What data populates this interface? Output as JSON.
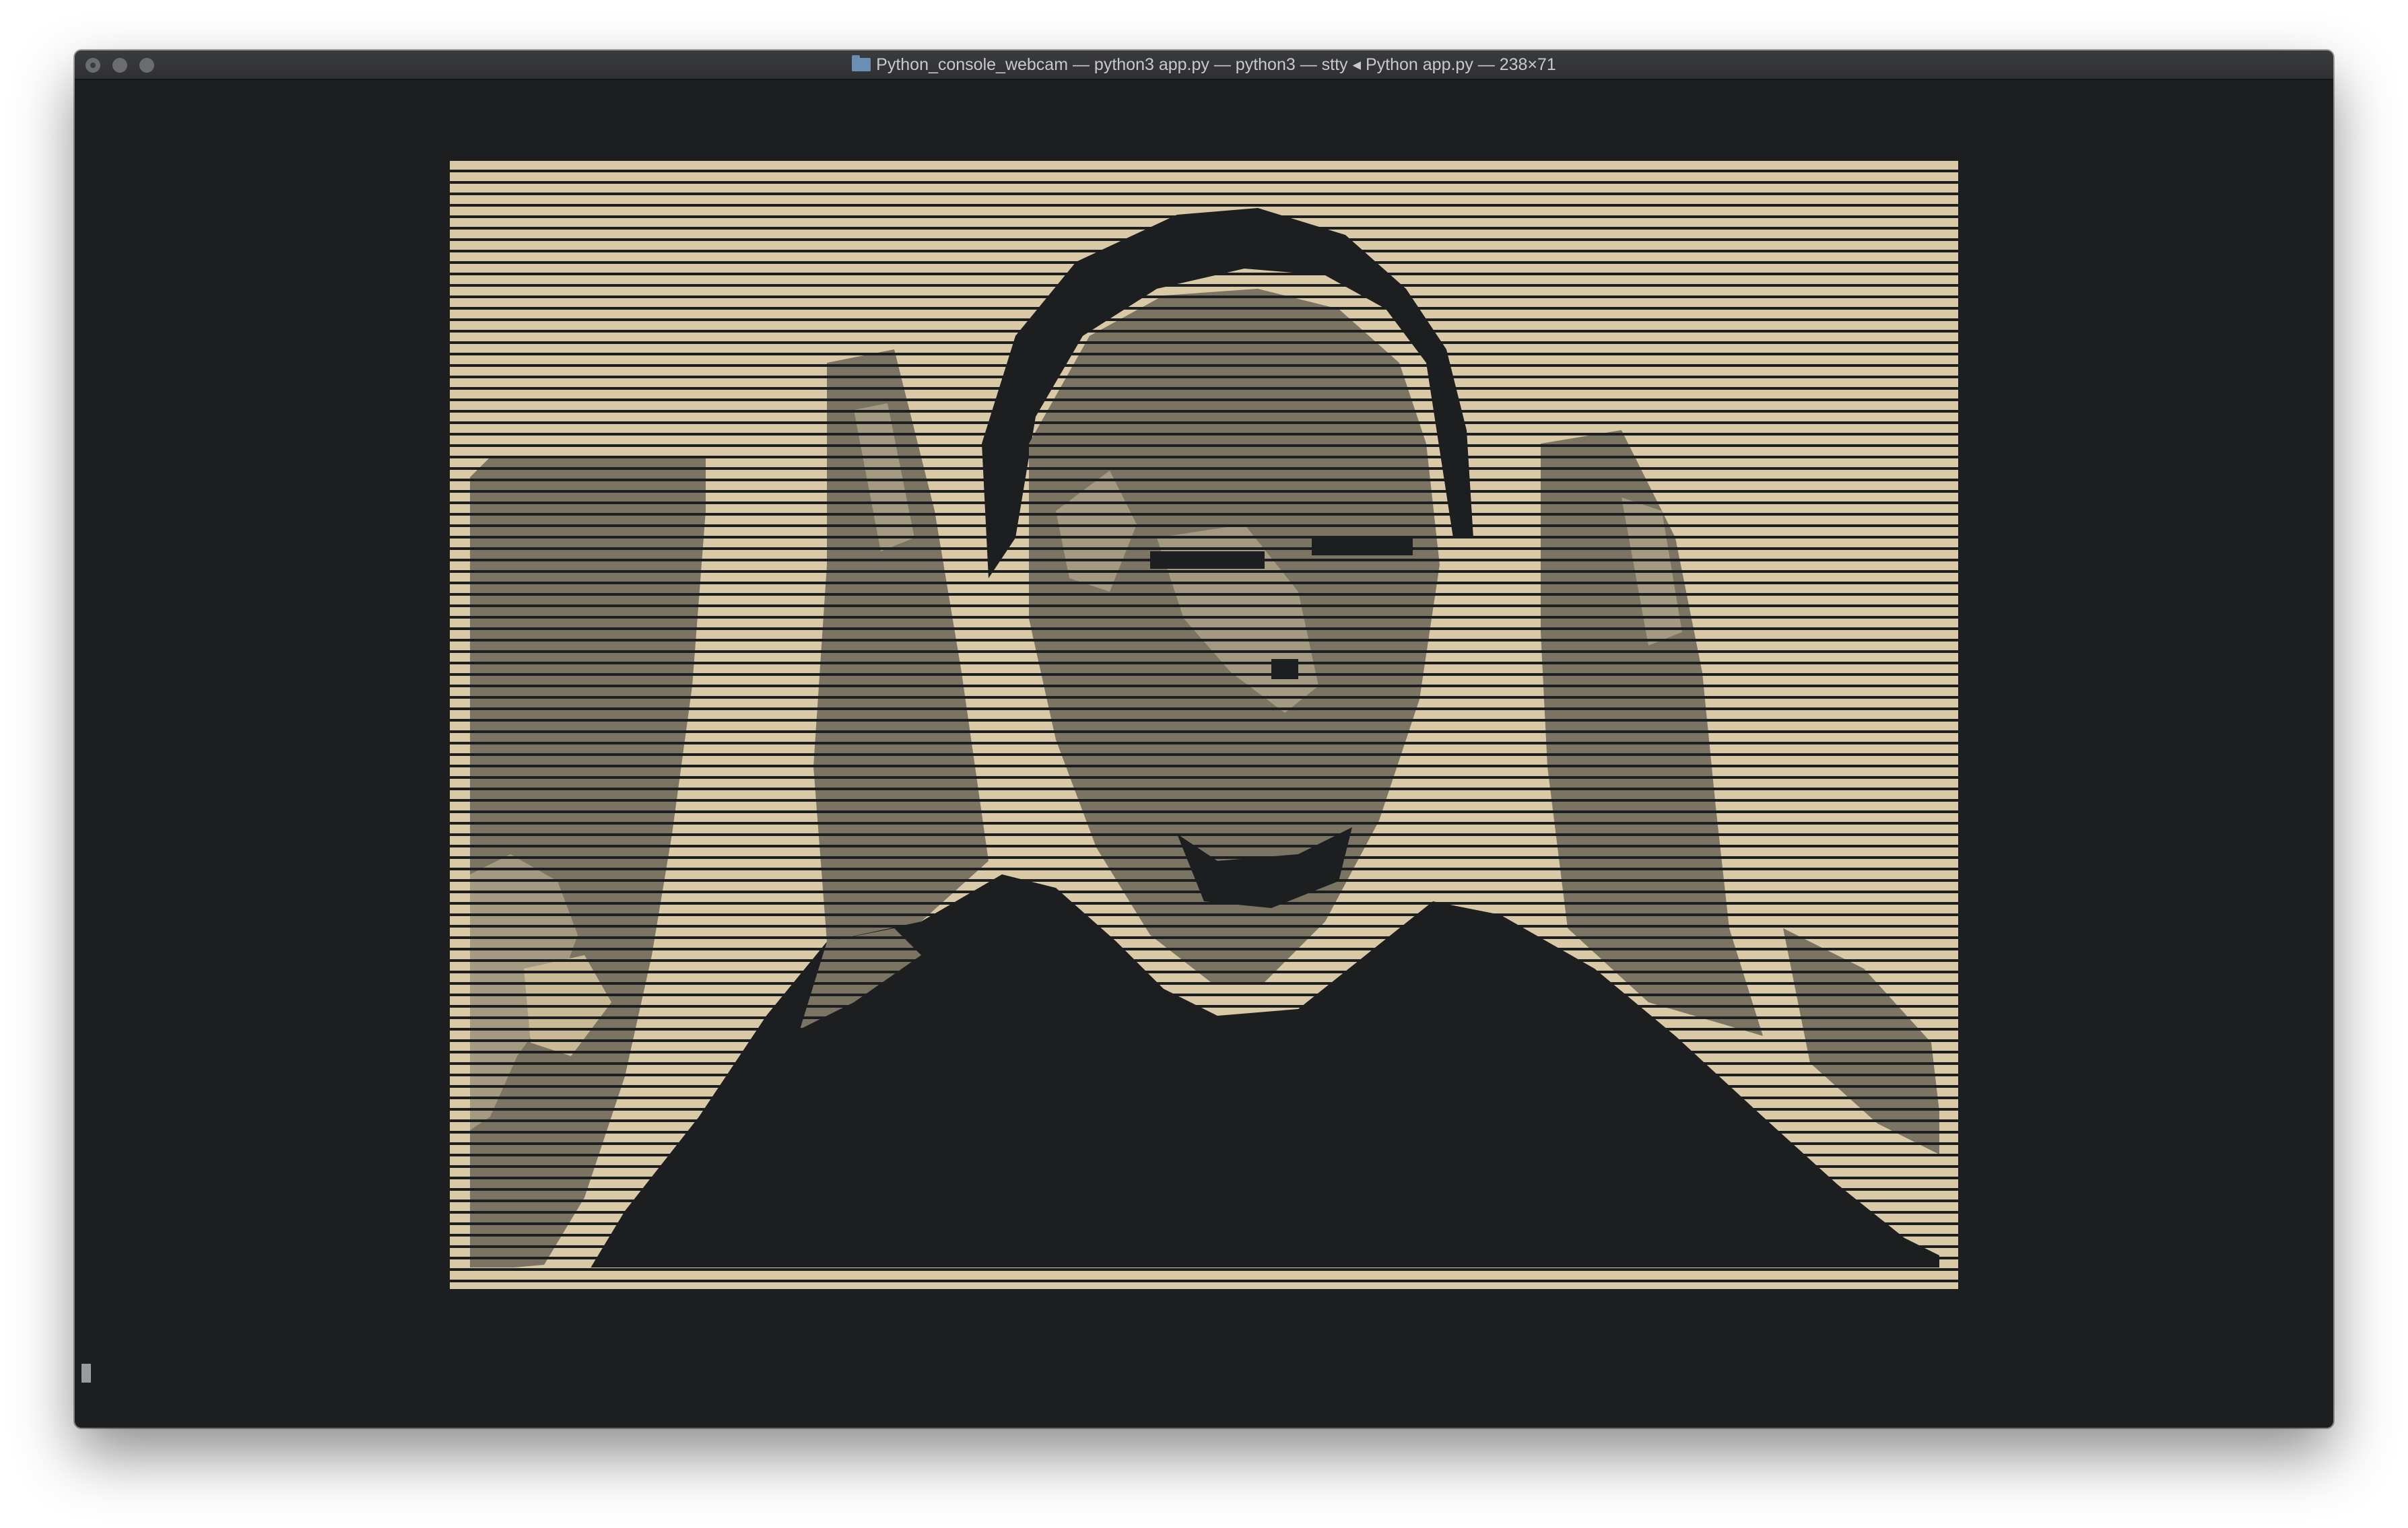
{
  "window": {
    "title": "Python_console_webcam — python3 app.py — python3 — stty ◂ Python app.py — 238×71",
    "title_icon": "folder-icon",
    "background": "#1d1e20",
    "traffic_lights": [
      "close-button",
      "minimize-button",
      "zoom-button"
    ]
  },
  "terminal": {
    "output": "ASCII-art webcam frame",
    "palette": {
      "light": "#d9c9a6",
      "mid": "#7b7463",
      "dark": "#1d1e20"
    },
    "cursor": "block-cursor"
  }
}
